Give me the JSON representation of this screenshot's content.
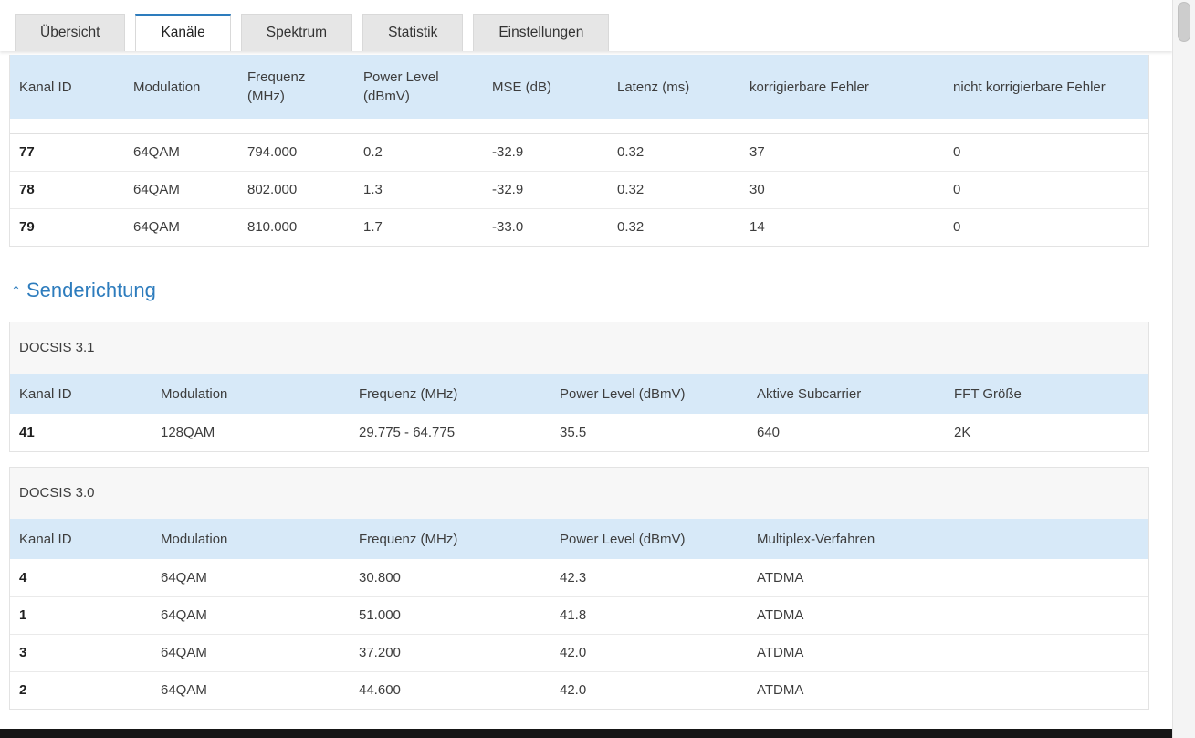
{
  "tabs": [
    {
      "label": "Übersicht",
      "active": false
    },
    {
      "label": "Kanäle",
      "active": true
    },
    {
      "label": "Spektrum",
      "active": false
    },
    {
      "label": "Statistik",
      "active": false
    },
    {
      "label": "Einstellungen",
      "active": false
    }
  ],
  "downstream_table": {
    "columns": [
      "Kanal ID",
      "Modulation",
      "Frequenz (MHz)",
      "Power Level (dBmV)",
      "MSE (dB)",
      "Latenz (ms)",
      "korrigierbare Fehler",
      "nicht korrigierbare Fehler"
    ],
    "rows": [
      [
        "77",
        "64QAM",
        "794.000",
        "0.2",
        "-32.9",
        "0.32",
        "37",
        "0"
      ],
      [
        "78",
        "64QAM",
        "802.000",
        "1.3",
        "-32.9",
        "0.32",
        "30",
        "0"
      ],
      [
        "79",
        "64QAM",
        "810.000",
        "1.7",
        "-33.0",
        "0.32",
        "14",
        "0"
      ]
    ]
  },
  "upstream": {
    "heading_arrow": "↑",
    "heading": "Senderichtung",
    "docsis31": {
      "title": "DOCSIS 3.1",
      "columns": [
        "Kanal ID",
        "Modulation",
        "Frequenz (MHz)",
        "Power Level (dBmV)",
        "Aktive Subcarrier",
        "FFT Größe"
      ],
      "rows": [
        [
          "41",
          "128QAM",
          "29.775 - 64.775",
          "35.5",
          "640",
          "2K"
        ]
      ]
    },
    "docsis30": {
      "title": "DOCSIS 3.0",
      "columns": [
        "Kanal ID",
        "Modulation",
        "Frequenz (MHz)",
        "Power Level (dBmV)",
        "Multiplex-Verfahren"
      ],
      "rows": [
        [
          "4",
          "64QAM",
          "30.800",
          "42.3",
          "ATDMA"
        ],
        [
          "1",
          "64QAM",
          "51.000",
          "41.8",
          "ATDMA"
        ],
        [
          "3",
          "64QAM",
          "37.200",
          "42.0",
          "ATDMA"
        ],
        [
          "2",
          "64QAM",
          "44.600",
          "42.0",
          "ATDMA"
        ]
      ]
    }
  },
  "colors": {
    "accent_blue": "#2d7cbd",
    "table_header_blue": "#d7e9f8",
    "section_title_gray": "#f7f7f7",
    "footer_dark": "#161616"
  }
}
